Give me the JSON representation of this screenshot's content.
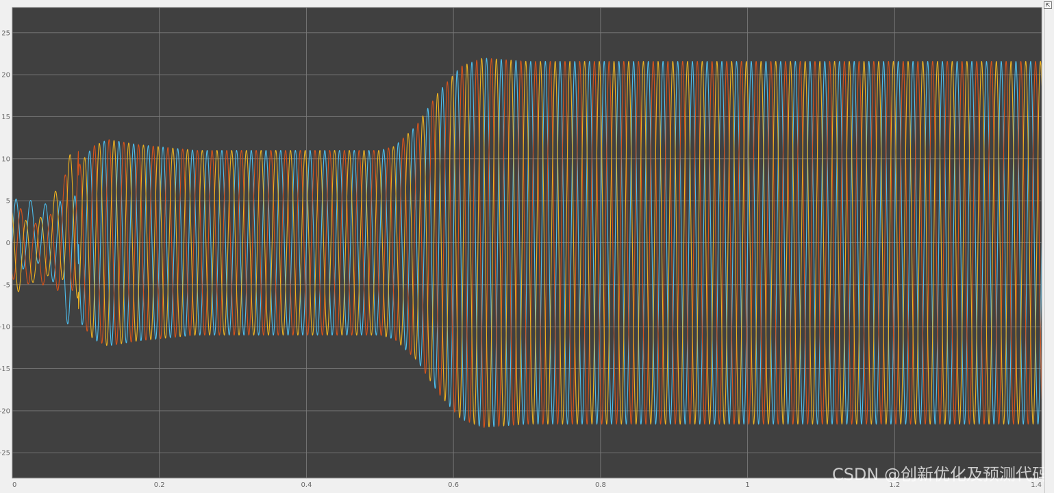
{
  "window": {
    "undock_button_icon": "undock-icon",
    "undock_button_glyph": "⇱"
  },
  "watermark": {
    "text": "CSDN @创新优化及预测代码"
  },
  "chart_data": {
    "type": "line",
    "title": "",
    "xlabel": "",
    "ylabel": "",
    "xlim": [
      0,
      1.4
    ],
    "ylim": [
      -28,
      28
    ],
    "grid": true,
    "legend": "none",
    "background": "#404040",
    "grid_color": "#7a7a7a",
    "x_ticks": [
      0,
      0.2,
      0.4,
      0.6,
      0.8,
      1,
      1.2,
      1.4
    ],
    "x_tick_labels": [
      "0",
      "0.2",
      "0.4",
      "0.6",
      "0.8",
      "1",
      "1.2",
      "1.4"
    ],
    "y_ticks": [
      -25,
      -20,
      -15,
      -10,
      -5,
      0,
      5,
      10,
      15,
      20,
      25
    ],
    "y_tick_labels": [
      "-25",
      "-20",
      "-15",
      "-10",
      "-5",
      "0",
      "5",
      "10",
      "15",
      "20",
      "25"
    ],
    "signal_frequency_hz": 50,
    "series": [
      {
        "color": "#4dbeee",
        "phase_deg": 0
      },
      {
        "color": "#d95319",
        "phase_deg": -120
      },
      {
        "color": "#edb120",
        "phase_deg": 120
      }
    ],
    "amplitude_envelope": {
      "x": [
        0,
        0.03,
        0.05,
        0.08,
        0.11,
        0.13,
        0.17,
        0.25,
        0.5,
        0.52,
        0.55,
        0.58,
        0.61,
        0.64,
        0.7,
        1.4
      ],
      "amplitude": [
        5,
        3.5,
        4,
        8,
        11.5,
        12.3,
        11.7,
        11,
        11,
        11.5,
        14,
        18,
        21,
        22,
        21.6,
        21.6
      ]
    }
  }
}
